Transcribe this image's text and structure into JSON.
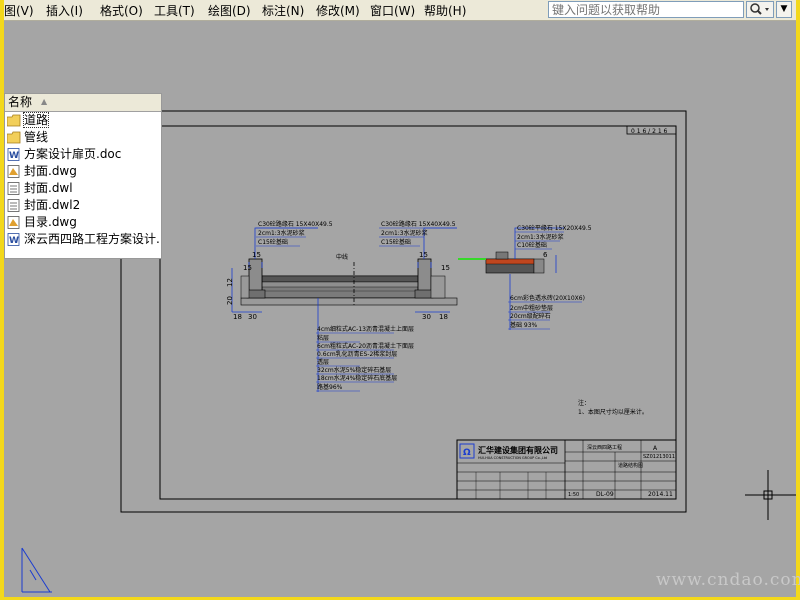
{
  "menubar": {
    "items": [
      {
        "label": "图(V)"
      },
      {
        "label": "插入(I)"
      },
      {
        "label": "格式(O)"
      },
      {
        "label": "工具(T)"
      },
      {
        "label": "绘图(D)"
      },
      {
        "label": "标注(N)"
      },
      {
        "label": "修改(M)"
      },
      {
        "label": "窗口(W)"
      },
      {
        "label": "帮助(H)"
      }
    ],
    "help_search_placeholder": "键入问题以获取帮助"
  },
  "file_panel": {
    "header": "名称",
    "items": [
      {
        "name": "道路",
        "icon": "folder-icon"
      },
      {
        "name": "管线",
        "icon": "folder-icon"
      },
      {
        "name": "方案设计扉页.doc",
        "icon": "word-doc-icon"
      },
      {
        "name": "封面.dwg",
        "icon": "dwg-file-icon"
      },
      {
        "name": "封面.dwl",
        "icon": "dwl-file-icon"
      },
      {
        "name": "封面.dwl2",
        "icon": "dwl-file-icon"
      },
      {
        "name": "目录.dwg",
        "icon": "dwg-file-icon"
      },
      {
        "name": "深云西四路工程方案设计.",
        "icon": "word-doc-icon"
      }
    ]
  },
  "drawing": {
    "page_number": "0 1 6 / 2 1 6",
    "centerline_label": "中线",
    "left_curb_notes": [
      "C30砼路缘石 15X40X49.5",
      "2cm1:3水泥砂浆",
      "C15砼基础"
    ],
    "right_curb_notes": [
      "C30砼路缘石 15X40X49.5",
      "2cm1:3水泥砂浆",
      "C15砼基础"
    ],
    "side_curb_notes": [
      "C30砼平缘石 15X20X49.5",
      "2cm1:3水泥砂浆",
      "C10砼基础"
    ],
    "dims": {
      "d15a": "15",
      "d15b": "15",
      "d15c": "15",
      "d15d": "15",
      "d12": "12",
      "d20": "20",
      "d18": "18",
      "d30a": "30",
      "d30b": "30",
      "d18b": "18",
      "d6": "6"
    },
    "sidewalk_layers": [
      "6cm彩色透水砖(20X10X6)",
      "2cm中粗砂垫层",
      "20cm级配碎石",
      "基础 93%"
    ],
    "pavement_layers": [
      "4cm细粒式AC-13沥青混凝土上面层",
      "粘层",
      "6cm粗粒式AC-20沥青混凝土下面层",
      "0.6cm乳化沥青ES-2稀浆封层",
      "透层",
      "32cm水泥5%稳定碎石基层",
      "18cm水泥4%稳定碎石底基层",
      "路基96%"
    ],
    "notes_title": "注：",
    "notes": [
      "1、本图尺寸均以厘米计。"
    ],
    "title_block": {
      "company_cn": "汇华建设集团有限公司",
      "company_en": "HUI-HUA CONSTRUCTION GROUP Co.,Ltd",
      "project": "深云西四路工程",
      "drawing_title": "道路结构图",
      "number": "DL-09",
      "date": "2014.11",
      "scale": "1:50",
      "serial": "SZ01213011",
      "rev": "A"
    }
  },
  "watermark": "www.cndao.com"
}
